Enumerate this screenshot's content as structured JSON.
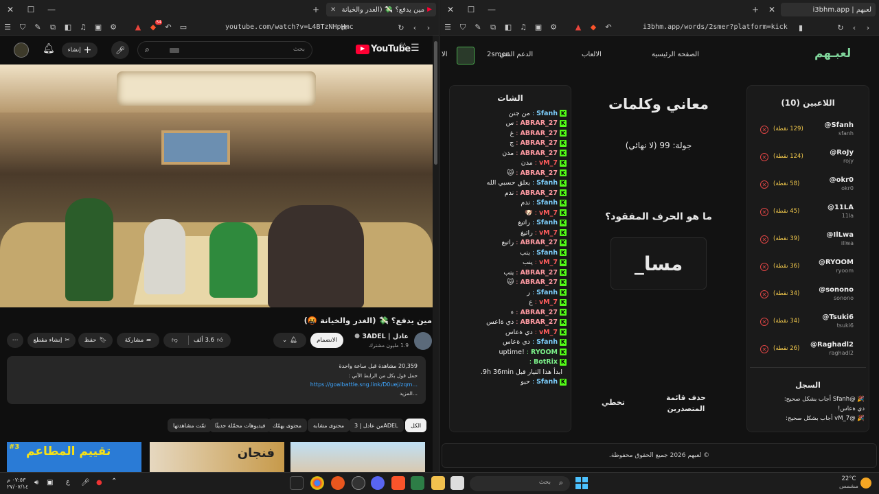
{
  "left_window": {
    "tab_title": "مين يدفع؟ 💸 (الغدر والخيانة 🤬)",
    "url": "youtube.com/watch?v=L4BTzNHpHmc",
    "brave_badge": "54",
    "yt": {
      "logo": "YouTube",
      "country": "SA",
      "search_placeholder": "بحث",
      "create_label": "إنشاء",
      "video_title": "مين يدفع؟ 💸 (الغدر والخيانة 🤬)",
      "channel_name": "عادل | 3ADEL",
      "subscribers": "1.9 مليون مشترك",
      "join_label": "الانضمام",
      "likes": "3.6 ألف",
      "share_label": "مشاركة",
      "save_label": "حفظ",
      "clip_label": "إنشاء مقطع",
      "views_line": "20,359 مشاهدة  قبل ساعة واحدة",
      "desc_line1": "حمل قول بكل من الرابط الآتي :",
      "desc_link": "https://goalbattle.sng.link/D0uej/zqm...",
      "more_label": "...المزيد",
      "chips": [
        "الكل",
        "من عادل | 3ADEL",
        "محتوى مشابه",
        "محتوى يهمّك",
        "فيديوهات محمّلة حديثًا",
        "تمّت مشاهدتها"
      ],
      "thumb1_text": "تقييم المطاعم",
      "thumb1_badge": "#3",
      "thumb2_text": "فنجان"
    }
  },
  "right_window": {
    "tab_title": "لعبهم | i3bhm.app",
    "url": "i3bhm.app/words/2smer?platform=kick",
    "nav": {
      "logo": "لعبـهم",
      "home": "الصفحة الرئيسية",
      "games": "الالعاب",
      "support": "الدعم الفني",
      "user": "2smer",
      "cut": "الا"
    },
    "players_title": "اللاعبين (10)",
    "players": [
      {
        "name": "@Sfanh",
        "user": "sfanh",
        "points": "(129 نقطة)"
      },
      {
        "name": "@RoJy",
        "user": "rojy",
        "points": "(124 نقطة)"
      },
      {
        "name": "@okr0",
        "user": "okr0",
        "points": "(58 نقطة)"
      },
      {
        "name": "@11LA",
        "user": "11la",
        "points": "(45 نقطة)"
      },
      {
        "name": "@IlLwa",
        "user": "illwa",
        "points": "(39 نقطة)"
      },
      {
        "name": "@RYOOM",
        "user": "ryoom",
        "points": "(36 نقطة)"
      },
      {
        "name": "@sonono",
        "user": "sonono",
        "points": "(34 نقطة)"
      },
      {
        "name": "@Tsuki6",
        "user": "tsuki6",
        "points": "(34 نقطة)"
      },
      {
        "name": "@Raghadl2",
        "user": "raghadl2",
        "points": "(26 نقطة)"
      }
    ],
    "log_title": "السجل",
    "log": [
      "🎉 @Sfanh أجاب بشكل صحيح:",
      "دي ةعاس!",
      "🎉 @vM_7 أجاب بشكل صحيح:"
    ],
    "game_title": "معاني وكلمات",
    "round": "جولة: 99 (لا نهائي)",
    "question": "ما هو الحرف المفقود؟",
    "puzzle": "مسا_",
    "skip": "تخطي",
    "clear_board": "حذف قائمة المتصدرين",
    "chat_title": "الشات",
    "chat": [
      {
        "name": "Sfanh",
        "color": "#7fd1ff",
        "msg": "من جنن"
      },
      {
        "name": "ABRAR_27",
        "color": "#ff9aa2",
        "msg": "س"
      },
      {
        "name": "ABRAR_27",
        "color": "#ff9aa2",
        "msg": "غ"
      },
      {
        "name": "ABRAR_27",
        "color": "#ff9aa2",
        "msg": "ج"
      },
      {
        "name": "ABRAR_27",
        "color": "#ff9aa2",
        "msg": "مدن"
      },
      {
        "name": "vM_7",
        "color": "#ff5c5c",
        "msg": "مدن"
      },
      {
        "name": "ABRAR_27",
        "color": "#ff9aa2",
        "msg": "🐱"
      },
      {
        "name": "Sfanh",
        "color": "#7fd1ff",
        "msg": "يعلق حسبي الله"
      },
      {
        "name": "ABRAR_27",
        "color": "#ff9aa2",
        "msg": "ندم"
      },
      {
        "name": "Sfanh",
        "color": "#7fd1ff",
        "msg": "ندم"
      },
      {
        "name": "vM_7",
        "color": "#ff5c5c",
        "msg": "🐶"
      },
      {
        "name": "Sfanh",
        "color": "#7fd1ff",
        "msg": "راتيغ"
      },
      {
        "name": "vM_7",
        "color": "#ff5c5c",
        "msg": "راتيغ"
      },
      {
        "name": "ABRAR_27",
        "color": "#ff9aa2",
        "msg": "راتيغ"
      },
      {
        "name": "Sfanh",
        "color": "#7fd1ff",
        "msg": "ينب"
      },
      {
        "name": "vM_7",
        "color": "#ff5c5c",
        "msg": "ينب"
      },
      {
        "name": "ABRAR_27",
        "color": "#ff9aa2",
        "msg": "ينب"
      },
      {
        "name": "ABRAR_27",
        "color": "#ff9aa2",
        "msg": "🐱"
      },
      {
        "name": "Sfanh",
        "color": "#7fd1ff",
        "msg": "ر"
      },
      {
        "name": "vM_7",
        "color": "#ff5c5c",
        "msg": "ع"
      },
      {
        "name": "ABRAR_27",
        "color": "#ff9aa2",
        "msg": "ء"
      },
      {
        "name": "ABRAR_27",
        "color": "#ff9aa2",
        "msg": "دي ةاعس"
      },
      {
        "name": "vM_7",
        "color": "#ff5c5c",
        "msg": "دي ةعاس"
      },
      {
        "name": "Sfanh",
        "color": "#7fd1ff",
        "msg": "دي ةعاس"
      },
      {
        "name": "RYOOM",
        "color": "#7cf28a",
        "msg": "!uptime"
      },
      {
        "name": "BotRix",
        "color": "#7cf28a",
        "msg": ""
      },
      {
        "name": "",
        "color": "#eee",
        "msg": "ابدأ هذا التيار قبل 9h 36min."
      },
      {
        "name": "Sfanh",
        "color": "#7fd1ff",
        "msg": "حيو"
      }
    ],
    "footer": "© لعبهم 2026 جميع الحقوق محفوظة."
  },
  "taskbar": {
    "weather_temp": "22°C",
    "weather_desc": "مشمس",
    "search_placeholder": "بحث",
    "time": "٠٧:٥٣ م",
    "date": "٢٧/٠٧/١٤",
    "lang": "ع"
  }
}
